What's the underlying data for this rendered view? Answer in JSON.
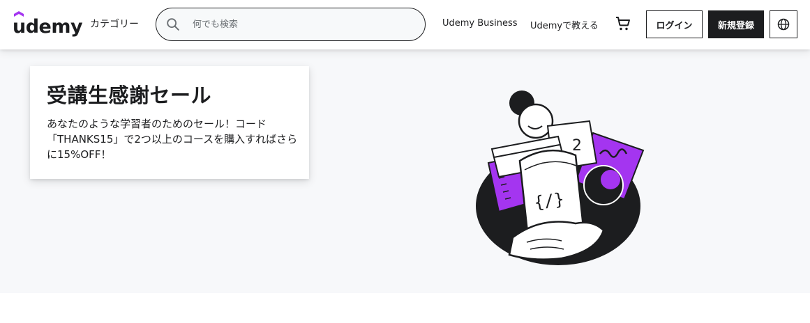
{
  "header": {
    "logo_text": "udemy",
    "categories_label": "カテゴリー",
    "search_placeholder": "何でも検索",
    "business_label": "Udemy Business",
    "teach_label": "Udemyで教える",
    "login_label": "ログイン",
    "signup_label": "新規登録",
    "brand_color": "#a435f0"
  },
  "hero": {
    "title": "受講生感謝セール",
    "body": "あなたのような学習者のためのセール！コード「THANKS15」で2つ以上のコースを購入すればさらに15%OFF！"
  }
}
